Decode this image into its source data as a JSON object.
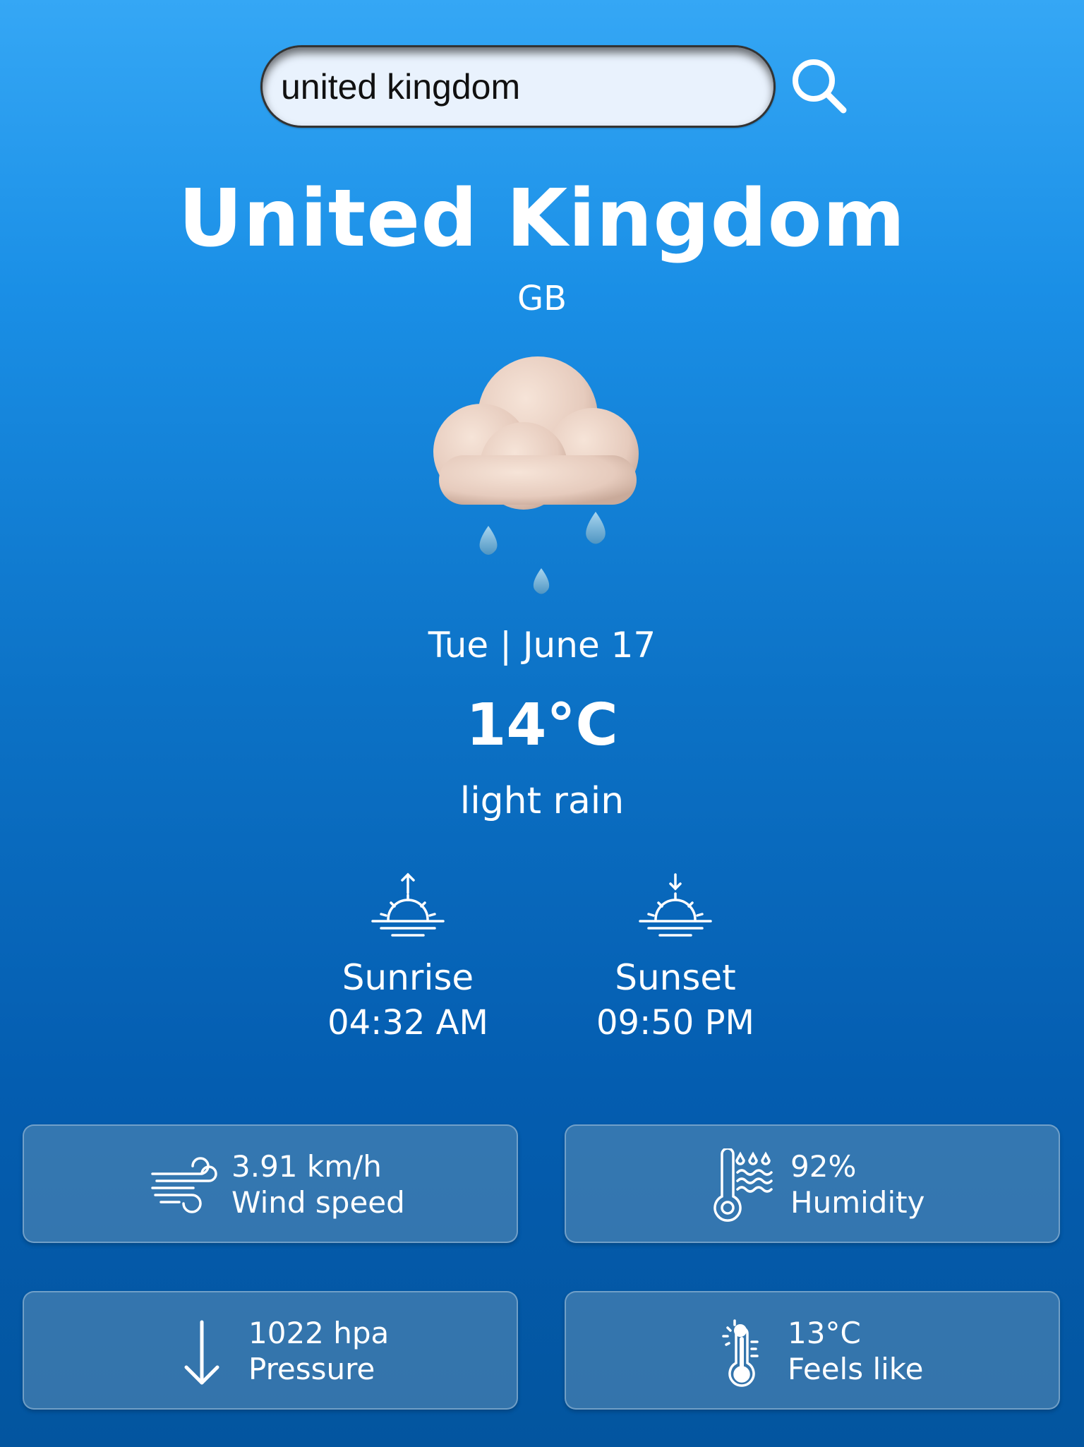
{
  "search": {
    "value": "united kingdom"
  },
  "location": {
    "city": "United Kingdom",
    "country": "GB"
  },
  "weather": {
    "icon": "rain-cloud-icon",
    "date": "Tue | June 17",
    "temperature": "14°C",
    "description": "light rain"
  },
  "sun": {
    "sunrise_label": "Sunrise",
    "sunrise_time": "04:32 AM",
    "sunset_label": "Sunset",
    "sunset_time": "09:50 PM"
  },
  "details": {
    "wind": {
      "value": "3.91 km/h",
      "label": "Wind speed",
      "icon": "wind-icon"
    },
    "humidity": {
      "value": "92%",
      "label": "Humidity",
      "icon": "humidity-icon"
    },
    "pressure": {
      "value": "1022 hpa",
      "label": "Pressure",
      "icon": "arrow-down-icon"
    },
    "feels_like": {
      "value": "13°C",
      "label": "Feels like",
      "icon": "thermometer-icon"
    }
  },
  "colors": {
    "background_top": "#35a7f5",
    "background_bottom": "#03559f",
    "card": "#5c8eb4",
    "search_field": "#e9f2fd"
  }
}
